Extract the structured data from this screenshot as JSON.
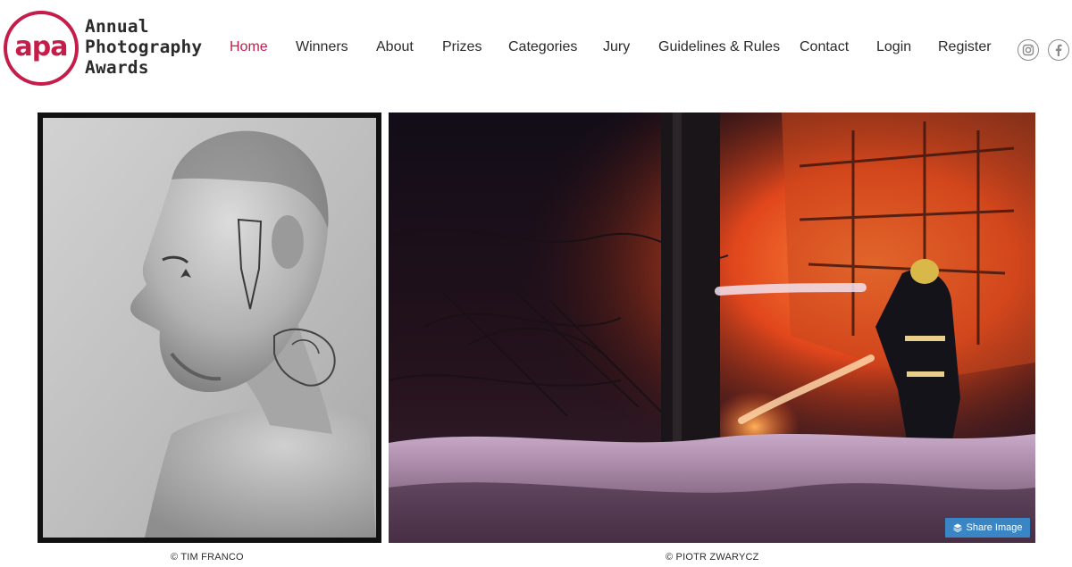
{
  "brand": {
    "mark": "apa",
    "lines": [
      "Annual",
      "Photography",
      "Awards"
    ],
    "accent_color": "#c41d4a"
  },
  "nav": {
    "items": [
      {
        "label": "Home",
        "active": true
      },
      {
        "label": "Winners"
      },
      {
        "label": "About"
      },
      {
        "label": "Prizes"
      },
      {
        "label": "Categories"
      },
      {
        "label": "Jury"
      },
      {
        "label": "Guidelines & Rules"
      },
      {
        "label": "Contact"
      },
      {
        "label": "Login"
      },
      {
        "label": "Register"
      }
    ],
    "social": [
      {
        "icon": "instagram-icon"
      },
      {
        "icon": "facebook-icon"
      }
    ]
  },
  "gallery": {
    "photos": [
      {
        "credit": "© TIM FRANCO",
        "subject": "portrait-photo"
      },
      {
        "credit": "© PIOTR ZWARYCZ",
        "subject": "firefighter-photo"
      }
    ],
    "share_label": "Share Image",
    "share_color": "#3a86c5"
  }
}
